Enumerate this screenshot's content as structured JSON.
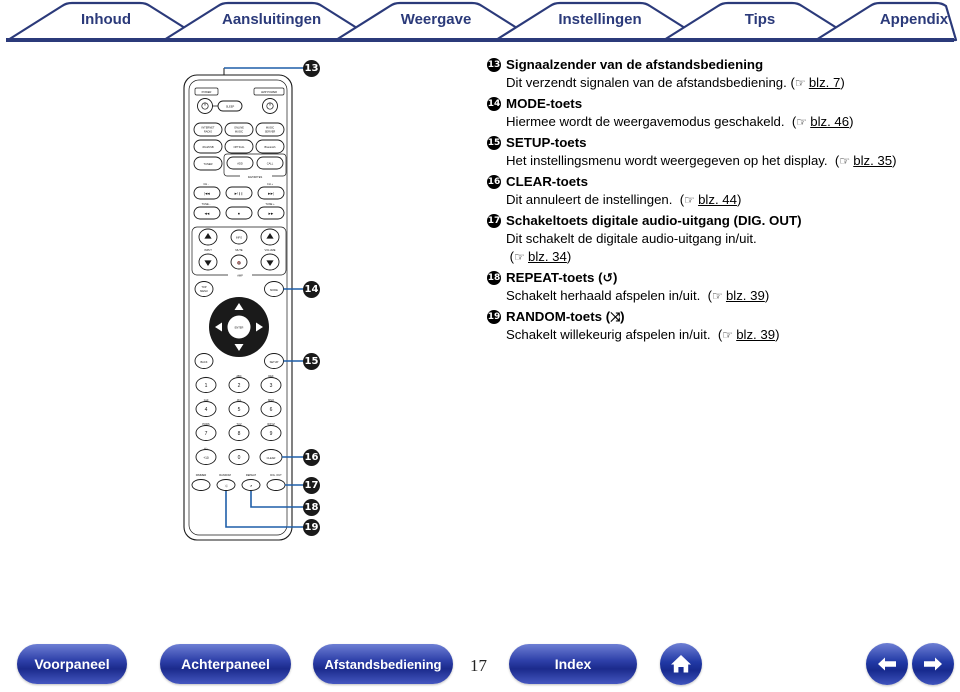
{
  "tabs": [
    {
      "label": "Inhoud",
      "name": "tab-inhoud"
    },
    {
      "label": "Aansluitingen",
      "name": "tab-aansluitingen"
    },
    {
      "label": "Weergave",
      "name": "tab-weergave"
    },
    {
      "label": "Instellingen",
      "name": "tab-instellingen"
    },
    {
      "label": "Tips",
      "name": "tab-tips"
    },
    {
      "label": "Appendix",
      "name": "tab-appendix"
    }
  ],
  "colors": {
    "tab_border": "#2b3a7a",
    "tab_text": "#2b3a7a",
    "rule": "#2b3a7a",
    "leader_line": "#1f5fa9",
    "callout_fill": "#1a1a1a",
    "button_blue": "#2139a5"
  },
  "figure": {
    "caption": "remote-control-diagram",
    "callouts": [
      {
        "num": "13"
      },
      {
        "num": "14"
      },
      {
        "num": "15"
      },
      {
        "num": "16"
      },
      {
        "num": "17"
      },
      {
        "num": "18"
      },
      {
        "num": "19"
      }
    ],
    "remote_labels": {
      "power": "POWER",
      "amp_power": "AMP POWER",
      "sleep": "SLEEP",
      "sources": [
        "INTERNET RADIO",
        "ONLINE MUSIC",
        "MUSIC SERVER",
        "iPod/USB",
        "OPTICAL",
        "Bluetooth",
        "TUNER"
      ],
      "favorites": {
        "title": "FAVORITES",
        "add": "ADD",
        "call": "CALL"
      },
      "transport": {
        "ch_minus": "CH -",
        "ch_plus": "CH +",
        "tune_minus": "TUNE -",
        "tune_plus": "TUNE +"
      },
      "amp": {
        "title": "AMP",
        "input": "INPUT",
        "info": "INFO",
        "mute": "MUTE",
        "volume": "VOLUME"
      },
      "nav": {
        "top_menu": "TOP MENU",
        "mode": "MODE",
        "enter": "ENTER",
        "back": "BACK",
        "setup": "SETUP"
      },
      "keypad": [
        "1",
        "2",
        "3",
        "4",
        "5",
        "6",
        "7",
        "8",
        "9",
        "+10",
        "0",
        "CLEAR"
      ],
      "keypad_letters": [
        "",
        "ABC",
        "DEF",
        "GHI",
        "JKL",
        "MNO",
        "PQRS",
        "TUV",
        "WXYZ"
      ],
      "bottom_row": [
        "DIMMER",
        "RANDOM",
        "REPEAT",
        "DIG. OUT"
      ]
    }
  },
  "content": {
    "items": [
      {
        "num": "13",
        "title": "Signaalzender van de afstandsbediening",
        "body": "Dit verzendt signalen van de afstandsbediening.",
        "ref_page": "blz. 7",
        "ref_inline": true
      },
      {
        "num": "14",
        "title": "MODE-toets",
        "body": "Hiermee wordt de weergavemodus geschakeld.",
        "ref_page": "blz. 46",
        "ref_inline": true
      },
      {
        "num": "15",
        "title": "SETUP-toets",
        "body": "Het instellingsmenu wordt weergegeven op het display.",
        "ref_page": "blz. 35",
        "ref_inline": true
      },
      {
        "num": "16",
        "title": "CLEAR-toets",
        "body": "Dit annuleert de instellingen.",
        "ref_page": "blz. 44",
        "ref_inline": true
      },
      {
        "num": "17",
        "title": "Schakeltoets digitale audio-uitgang (DIG. OUT)",
        "body": "Dit schakelt de digitale audio-uitgang in/uit.",
        "ref_page": "blz. 34",
        "ref_inline": false
      },
      {
        "num": "18",
        "title": "REPEAT-toets (",
        "title_symbol": "↺",
        "title_suffix": ")",
        "body": "Schakelt herhaald afspelen in/uit.",
        "ref_page": "blz. 39",
        "ref_inline": true
      },
      {
        "num": "19",
        "title": "RANDOM-toets (",
        "title_symbol": "⤨",
        "title_suffix": ")",
        "body": "Schakelt willekeurig afspelen in/uit.",
        "ref_page": "blz. 39",
        "ref_inline": true
      }
    ],
    "hand_glyph": "☞",
    "paren_open": "(",
    "paren_close": ")"
  },
  "footer": {
    "buttons": [
      {
        "label": "Voorpaneel",
        "name": "footer-voorpaneel-button"
      },
      {
        "label": "Achterpaneel",
        "name": "footer-achterpaneel-button"
      },
      {
        "label": "Afstandsbediening",
        "name": "footer-afstandsbediening-button"
      },
      {
        "label": "Index",
        "name": "footer-index-button"
      }
    ],
    "page_number": "17",
    "home_icon": "home-icon",
    "prev_icon": "arrow-left-icon",
    "next_icon": "arrow-right-icon"
  }
}
